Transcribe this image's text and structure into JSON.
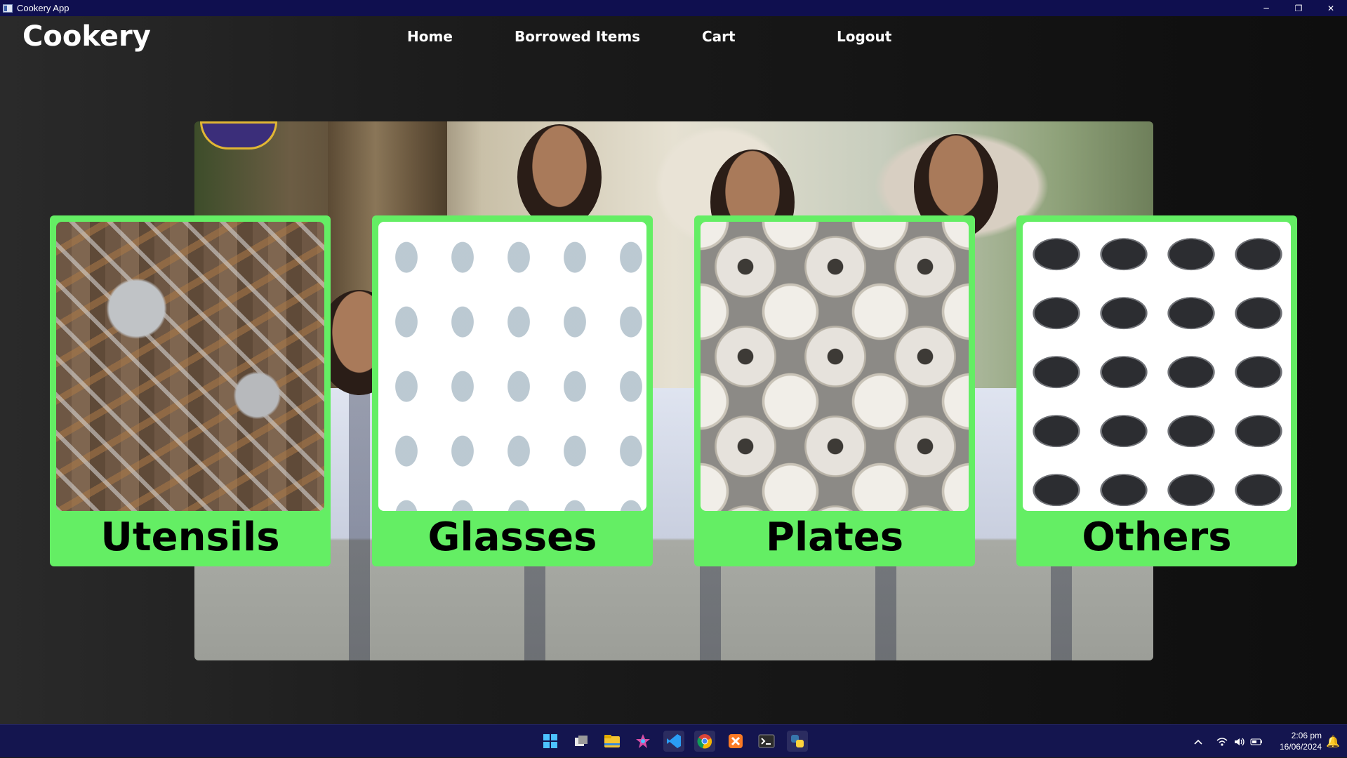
{
  "window": {
    "title": "Cookery App",
    "controls": {
      "minimize": "─",
      "restore": "❐",
      "close": "✕"
    }
  },
  "header": {
    "brand": "Cookery",
    "nav": [
      "Home",
      "Borrowed Items",
      "Cart",
      "Logout"
    ]
  },
  "categories": [
    {
      "label": "Utensils",
      "image": "utensils-pattern"
    },
    {
      "label": "Glasses",
      "image": "glasses-pattern"
    },
    {
      "label": "Plates",
      "image": "plates-pattern"
    },
    {
      "label": "Others",
      "image": "cookware-pattern"
    }
  ],
  "colors": {
    "card_green": "#64ee64",
    "titlebar": "#0f0f4f",
    "taskbar": "#14154f"
  },
  "taskbar": {
    "icons": [
      "windows-start-icon",
      "task-view-icon",
      "file-explorer-icon",
      "app-icon",
      "vscode-icon",
      "chrome-icon",
      "xampp-icon",
      "terminal-icon",
      "python-icon"
    ],
    "tray_icons": [
      "chevron-up-icon",
      "wifi-icon",
      "volume-icon",
      "battery-icon"
    ],
    "time": "2:06 pm",
    "date": "16/06/2024"
  }
}
